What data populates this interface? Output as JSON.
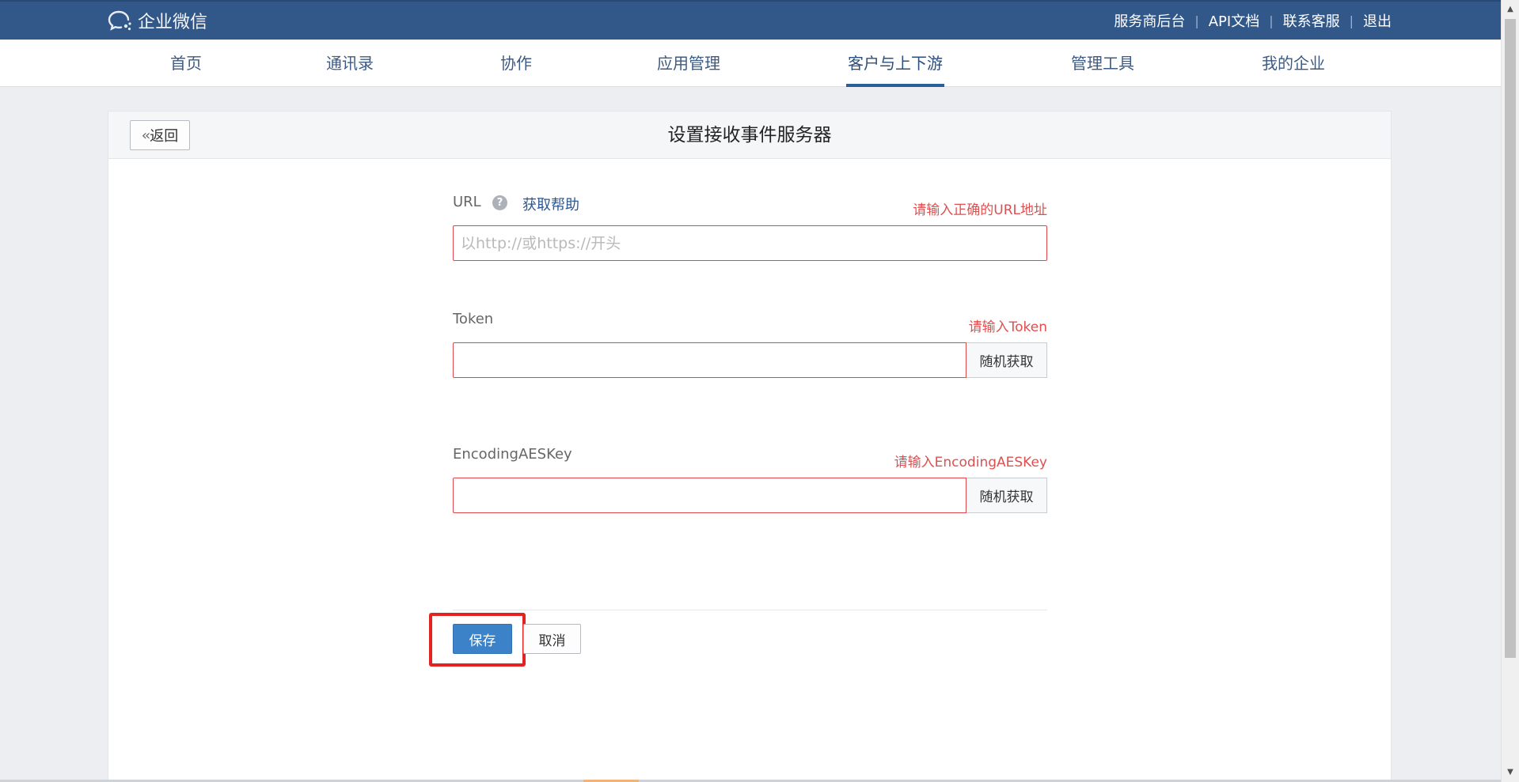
{
  "header": {
    "logo_text": "企业微信",
    "links": [
      "服务商后台",
      "API文档",
      "联系客服",
      "退出"
    ],
    "separator": "|"
  },
  "nav": {
    "tabs": [
      "首页",
      "通讯录",
      "协作",
      "应用管理",
      "客户与上下游",
      "管理工具",
      "我的企业"
    ],
    "active_index": 4
  },
  "panel": {
    "back_label": "返回",
    "title": "设置接收事件服务器"
  },
  "form": {
    "url": {
      "label": "URL",
      "help_icon": "?",
      "help_link": "获取帮助",
      "error": "请输入正确的URL地址",
      "placeholder": "以http://或https://开头",
      "value": ""
    },
    "token": {
      "label": "Token",
      "error": "请输入Token",
      "value": "",
      "random_label": "随机获取"
    },
    "aeskey": {
      "label": "EncodingAESKey",
      "error": "请输入EncodingAESKey",
      "value": "",
      "random_label": "随机获取"
    }
  },
  "actions": {
    "save_label": "保存",
    "cancel_label": "取消"
  },
  "colors": {
    "header_bg": "#32588a",
    "accent": "#3b82c9",
    "error": "#e04f4f",
    "highlight": "#e32222"
  }
}
